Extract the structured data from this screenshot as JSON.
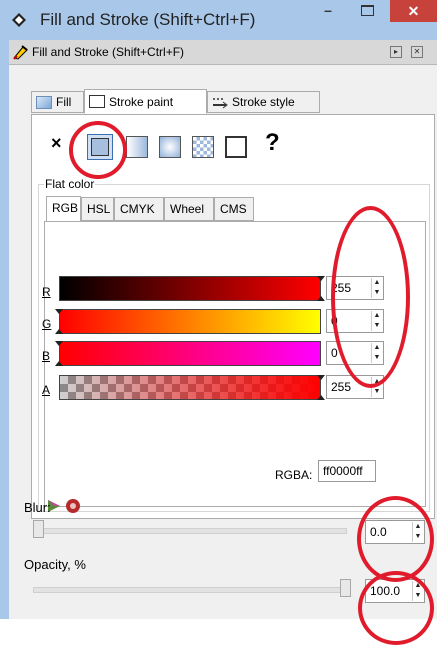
{
  "window": {
    "title": "Fill and Stroke (Shift+Ctrl+F)",
    "minimize_glyph": "–",
    "close_glyph": "✕"
  },
  "dock": {
    "title": "Fill and Stroke (Shift+Ctrl+F)"
  },
  "tabs": [
    {
      "label": "Fill",
      "active": false
    },
    {
      "label": "Stroke paint",
      "active": true
    },
    {
      "label": "Stroke style",
      "active": false
    }
  ],
  "paint_types": {
    "none_glyph": "×",
    "unset_glyph": "?",
    "selected": "flat-color"
  },
  "flat_color": {
    "legend": "Flat color",
    "mode_tabs": [
      "RGB",
      "HSL",
      "CMYK",
      "Wheel",
      "CMS"
    ],
    "active_mode": "RGB",
    "channels": [
      {
        "label": "R",
        "value": "255"
      },
      {
        "label": "G",
        "value": "0"
      },
      {
        "label": "B",
        "value": "0"
      },
      {
        "label": "A",
        "value": "255"
      }
    ],
    "rgba_label": "RGBA:",
    "rgba_value": "ff0000ff"
  },
  "blur": {
    "label": "Blur:",
    "value": "0.0",
    "level_percent": 0
  },
  "opacity": {
    "label": "Opacity, %",
    "value": "100.0",
    "level_percent": 100
  },
  "colors": {
    "titlebar": "#a9c7e8",
    "close_button": "#c7423a",
    "annotation_red": "#e01b2b",
    "current_color": "#ff0000"
  }
}
